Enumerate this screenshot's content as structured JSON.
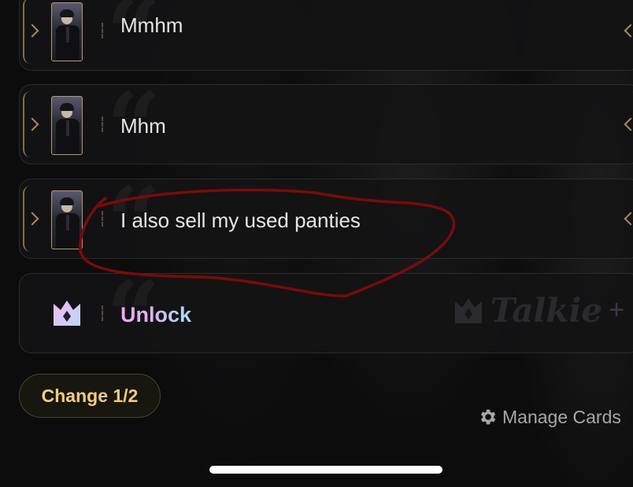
{
  "messages": [
    {
      "text": "Mmhm"
    },
    {
      "text": "Mhm"
    },
    {
      "text": "I also sell my used panties"
    }
  ],
  "unlock": {
    "label": "Unlock",
    "icon": "crown-icon"
  },
  "brand": {
    "name": "Talkie",
    "plus": "+"
  },
  "buttons": {
    "change": "Change 1/2",
    "manage_cards": "Manage Cards"
  },
  "colors": {
    "accent_gold": "#f1cc7c",
    "frame_gold": "#8a6d44",
    "scribble": "#7a0b0b"
  }
}
